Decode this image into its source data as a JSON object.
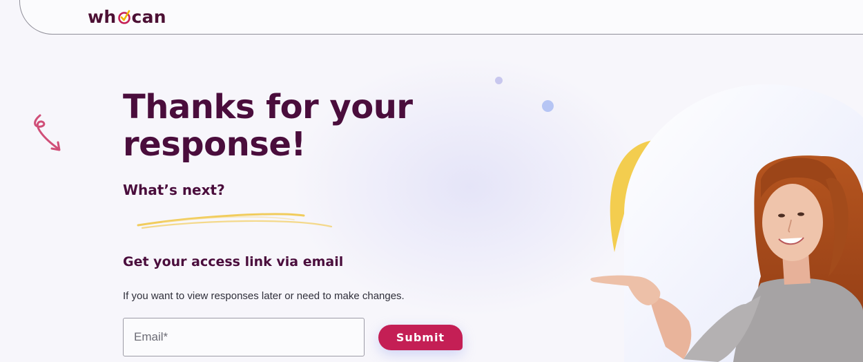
{
  "header": {
    "logo_part1": "wh",
    "logo_part2": "can",
    "logo_icon": "checkmark-o-icon"
  },
  "main": {
    "headline": "Thanks for your response!",
    "subhead": "What’s next?",
    "section_title": "Get your access link via email",
    "description": "If you want to view responses later or need to make changes."
  },
  "form": {
    "email_placeholder": "Email*",
    "email_value": "",
    "submit_label": "Submit"
  },
  "colors": {
    "brand": "#4a0d3c",
    "accent": "#c41f55",
    "highlight": "#f0c84a"
  }
}
